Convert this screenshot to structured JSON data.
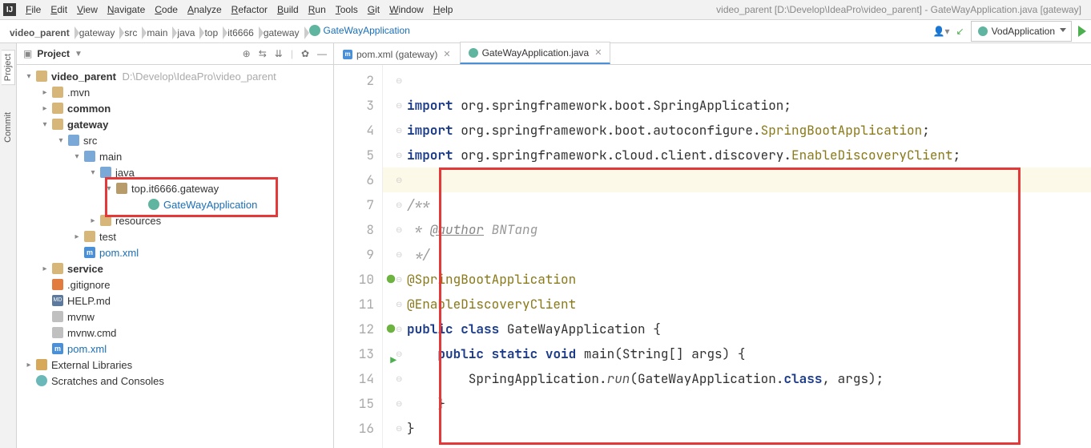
{
  "menubar": {
    "items": [
      "File",
      "Edit",
      "View",
      "Navigate",
      "Code",
      "Analyze",
      "Refactor",
      "Build",
      "Run",
      "Tools",
      "Git",
      "Window",
      "Help"
    ],
    "title": "video_parent [D:\\Develop\\IdeaPro\\video_parent] - GateWayApplication.java [gateway]"
  },
  "breadcrumbs": [
    "video_parent",
    "gateway",
    "src",
    "main",
    "java",
    "top",
    "it6666",
    "gateway",
    "GateWayApplication"
  ],
  "run_config": "VodApplication",
  "panel": {
    "title": "Project"
  },
  "tree": {
    "root": {
      "name": "video_parent",
      "path": "D:\\Develop\\IdeaPro\\video_parent"
    },
    "mvn": ".mvn",
    "common": "common",
    "gateway": "gateway",
    "src": "src",
    "main": "main",
    "java": "java",
    "pkg": "top.it6666.gateway",
    "cls": "GateWayApplication",
    "resources": "resources",
    "test": "test",
    "pom1": "pom.xml",
    "service": "service",
    "gitignore": ".gitignore",
    "help": "HELP.md",
    "mvnw": "mvnw",
    "mvnwcmd": "mvnw.cmd",
    "pom2": "pom.xml",
    "extlib": "External Libraries",
    "scratch": "Scratches and Consoles"
  },
  "tabs": [
    {
      "label": "pom.xml (gateway)",
      "type": "m"
    },
    {
      "label": "GateWayApplication.java",
      "type": "c",
      "active": true
    }
  ],
  "code": {
    "lines": [
      {
        "n": 2,
        "html": ""
      },
      {
        "n": 3,
        "html": "<span class='kw'>import</span> org.springframework.boot.SpringApplication;"
      },
      {
        "n": 4,
        "html": "<span class='kw'>import</span> org.springframework.boot.autoconfigure.<span class='cls'>SpringBootApplication</span>;"
      },
      {
        "n": 5,
        "html": "<span class='kw'>import</span> org.springframework.cloud.client.discovery.<span class='cls'>EnableDiscoveryClient</span>;"
      },
      {
        "n": 6,
        "html": "",
        "hl": true
      },
      {
        "n": 7,
        "html": "<span class='cmt'>/**</span>"
      },
      {
        "n": 8,
        "html": "<span class='cmt'> * </span><span class='cmt-tag'>@author</span><span class='cmt'> BNTang</span>"
      },
      {
        "n": 9,
        "html": "<span class='cmt'> */</span>"
      },
      {
        "n": 10,
        "html": "<span class='ann'>@SpringBootApplication</span>",
        "spring": true
      },
      {
        "n": 11,
        "html": "<span class='ann'>@EnableDiscoveryClient</span>"
      },
      {
        "n": 12,
        "html": "<span class='kw'>public</span> <span class='kw'>class</span> <span>GateWayApplication</span> {",
        "spring": true
      },
      {
        "n": 13,
        "html": "    <span class='kw'>public</span> <span class='kw'>static</span> <span class='kw'>void</span> main(String[] args) {",
        "run": true
      },
      {
        "n": 14,
        "html": "        SpringApplication.<span class='fn-i'>run</span>(GateWayApplication.<span class='kw'>class</span>, args);"
      },
      {
        "n": 15,
        "html": "    }"
      },
      {
        "n": 16,
        "html": "}"
      }
    ]
  },
  "sidetabs": {
    "project": "Project",
    "commit": "Commit"
  }
}
